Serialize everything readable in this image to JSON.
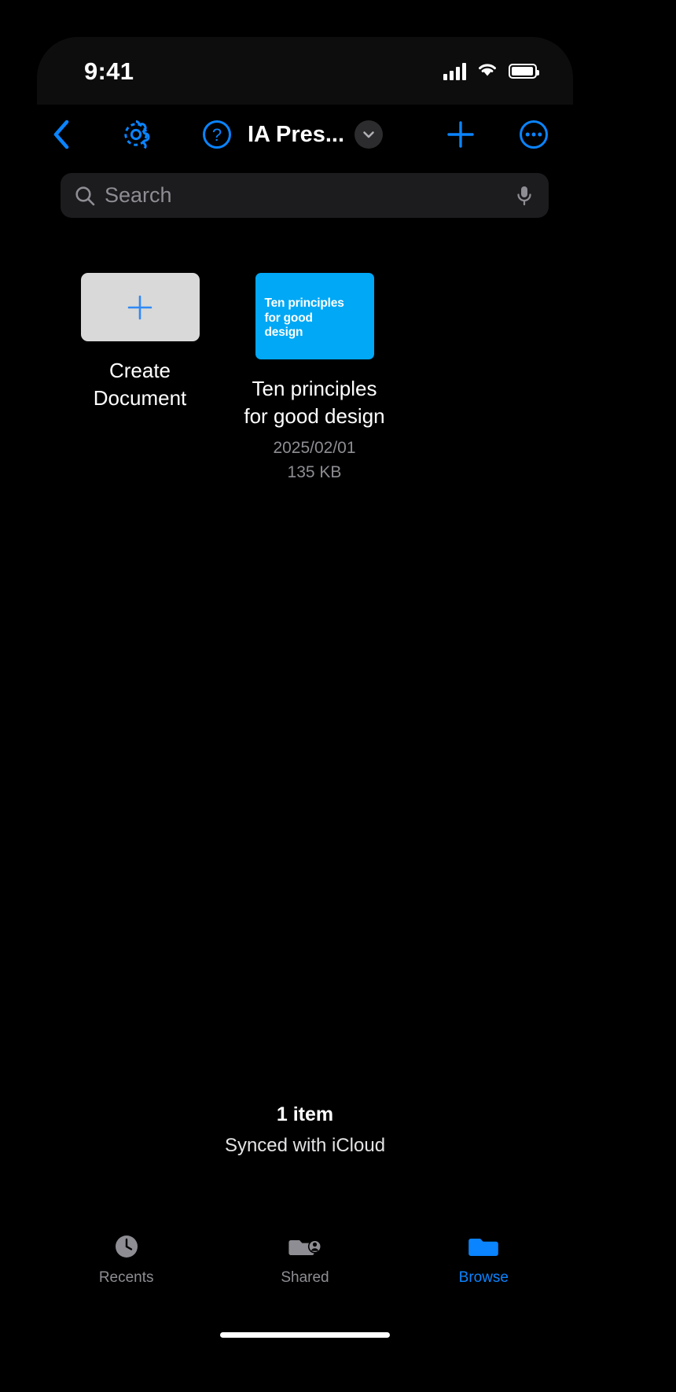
{
  "status_bar": {
    "time": "9:41",
    "cellular_icon": "signal-bars-icon",
    "wifi_icon": "wifi-icon",
    "battery_icon": "battery-icon"
  },
  "nav_bar": {
    "back_icon": "chevron-left-icon",
    "settings_icon": "gear-icon",
    "help_icon": "question-mark-circle-icon",
    "title": "IA Pres...",
    "title_chevron_icon": "chevron-down-icon",
    "add_icon": "plus-icon",
    "more_icon": "ellipsis-circle-icon",
    "accent_color": "#0a84ff"
  },
  "search": {
    "placeholder": "Search",
    "value": "",
    "search_icon": "magnifier-icon",
    "mic_icon": "microphone-icon"
  },
  "grid": {
    "create": {
      "plus_icon": "plus-icon",
      "label_line1": "Create",
      "label_line2": "Document",
      "thumb_color": "#d9d9d9"
    },
    "documents": [
      {
        "thumb_text_line1": "Ten principles",
        "thumb_text_line2": "for good",
        "thumb_text_line3": "design",
        "thumb_color": "#00a8f5",
        "title_line1": "Ten principles",
        "title_line2": "for good design",
        "date": "2025/02/01",
        "size": "135 KB"
      }
    ]
  },
  "footer": {
    "item_count": "1 item",
    "sync_status": "Synced with iCloud"
  },
  "tab_bar": {
    "tabs": [
      {
        "label": "Recents",
        "icon": "clock-icon",
        "active": false
      },
      {
        "label": "Shared",
        "icon": "folder-person-icon",
        "active": false
      },
      {
        "label": "Browse",
        "icon": "folder-icon",
        "active": true
      }
    ],
    "active_color": "#0a84ff",
    "inactive_color": "#8d8d93"
  }
}
